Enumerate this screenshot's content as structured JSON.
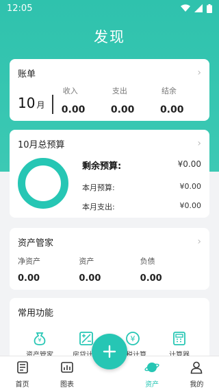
{
  "colors": {
    "accent": "#26c6b4",
    "header": "#32c3ae"
  },
  "status": {
    "time": "12:05"
  },
  "page": {
    "title": "发现"
  },
  "bill": {
    "title": "账单",
    "month_num": "10",
    "month_unit": "月",
    "columns": [
      {
        "label": "收入",
        "value": "0.00"
      },
      {
        "label": "支出",
        "value": "0.00"
      },
      {
        "label": "结余",
        "value": "0.00"
      }
    ]
  },
  "budget": {
    "title": "10月总预算",
    "remaining_label": "剩余预算:",
    "remaining_value": "¥0.00",
    "month_label": "本月预算:",
    "month_value": "¥0.00",
    "spent_label": "本月支出:",
    "spent_value": "¥0.00"
  },
  "assets": {
    "title": "资产管家",
    "columns": [
      {
        "label": "净资产",
        "value": "0.00"
      },
      {
        "label": "资产",
        "value": "0.00"
      },
      {
        "label": "负债",
        "value": "0.00"
      }
    ]
  },
  "functions": {
    "title": "常用功能",
    "items": [
      {
        "label": "资产管家",
        "icon": "money-bag-icon"
      },
      {
        "label": "房贷计算",
        "icon": "calculator-grid-icon"
      },
      {
        "label": "个税计算",
        "icon": "yen-coin-icon"
      },
      {
        "label": "计算器",
        "icon": "calculator-icon"
      }
    ]
  },
  "tabs": [
    {
      "label": "首页",
      "icon": "list-icon"
    },
    {
      "label": "图表",
      "icon": "chart-icon"
    },
    {
      "label": "资产",
      "icon": "planet-icon"
    },
    {
      "label": "我的",
      "icon": "user-icon"
    }
  ]
}
